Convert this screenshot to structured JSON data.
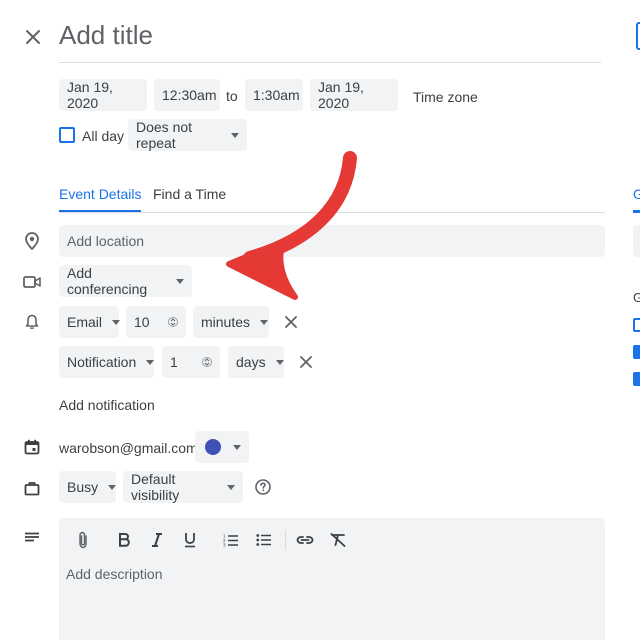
{
  "header": {
    "title_placeholder": "Add title"
  },
  "datetime": {
    "start_date": "Jan 19, 2020",
    "start_time": "12:30am",
    "to_label": "to",
    "end_time": "1:30am",
    "end_date": "Jan 19, 2020",
    "timezone_label": "Time zone"
  },
  "allday": {
    "label": "All day",
    "checked": false,
    "repeat": "Does not repeat"
  },
  "tabs": [
    {
      "label": "Event Details",
      "active": true
    },
    {
      "label": "Find a Time",
      "active": false
    }
  ],
  "location": {
    "placeholder": "Add location"
  },
  "conferencing": {
    "label": "Add conferencing"
  },
  "notifications": [
    {
      "method": "Email",
      "value": "10",
      "unit": "minutes"
    },
    {
      "method": "Notification",
      "value": "1",
      "unit": "days"
    }
  ],
  "add_notification_label": "Add notification",
  "calendar": {
    "owner": "warobson@gmail.com",
    "color": "#3f51b5"
  },
  "availability": {
    "status": "Busy",
    "visibility": "Default visibility"
  },
  "description": {
    "placeholder": "Add description"
  },
  "right_panel": {
    "tab_letter": "G",
    "section_letter": "G"
  },
  "colors": {
    "accent": "#1a73e8",
    "annotation_arrow": "#e53935",
    "chip_bg": "#f1f3f4"
  }
}
